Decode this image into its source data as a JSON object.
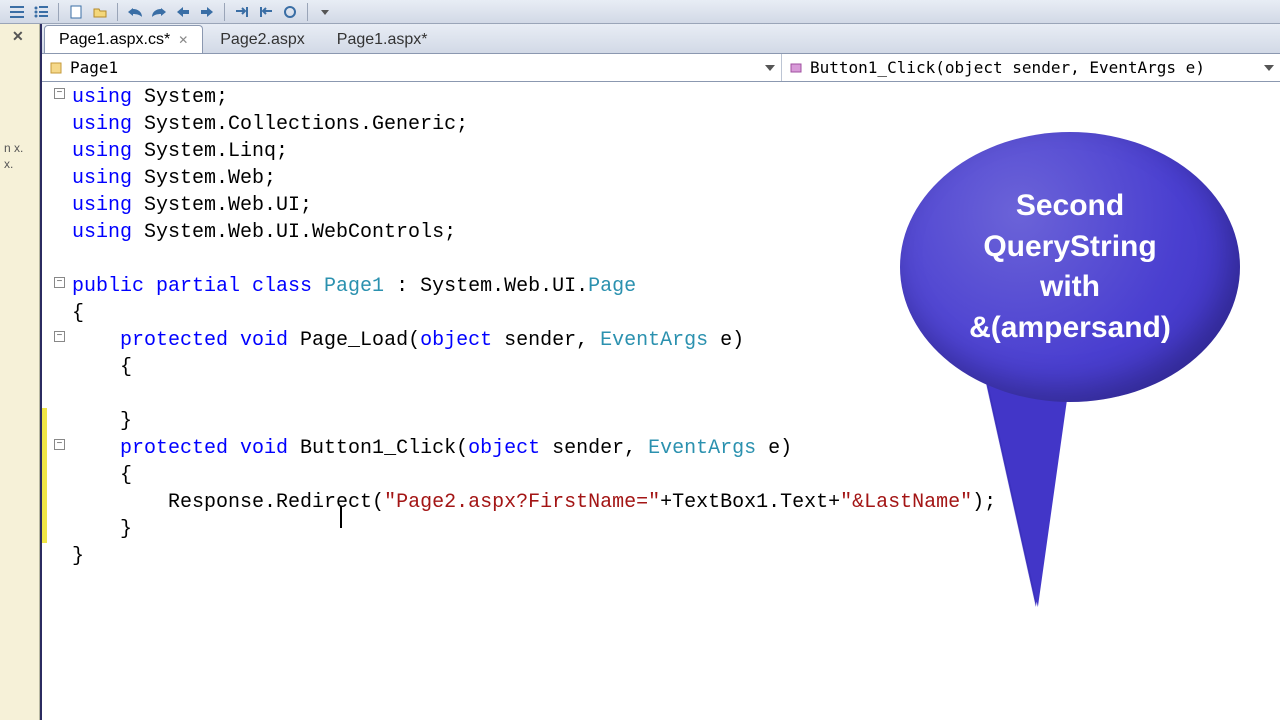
{
  "toolbar": {
    "buttons": [
      "menu",
      "list",
      "sep",
      "new",
      "open",
      "save",
      "sep",
      "undo",
      "redo",
      "back",
      "fwd",
      "sep",
      "step-out",
      "step-over",
      "stop",
      "sep",
      "dropdown"
    ]
  },
  "left_pane": {
    "text": "n\nx.\nx."
  },
  "tabs": [
    {
      "label": "Page1.aspx.cs*",
      "active": true,
      "closable": true
    },
    {
      "label": "Page2.aspx",
      "active": false,
      "closable": false
    },
    {
      "label": "Page1.aspx*",
      "active": false,
      "closable": false
    }
  ],
  "dropdowns": {
    "left": "Page1",
    "right": "Button1_Click(object sender, EventArgs e)"
  },
  "code": {
    "l1": "using",
    "l1b": " System;",
    "l2": "using",
    "l2b": " System.Collections.Generic;",
    "l3": "using",
    "l3b": " System.Linq;",
    "l4": "using",
    "l4b": " System.Web;",
    "l5": "using",
    "l5b": " System.Web.UI;",
    "l6": "using",
    "l6b": " System.Web.UI.WebControls;",
    "l8a": "public",
    "l8b": " partial",
    "l8c": " class",
    "l8d": " Page1",
    "l8e": " : System.Web.UI.",
    "l8f": "Page",
    "l9": "{",
    "l10a": "    protected",
    "l10b": " void",
    "l10c": " Page_Load(",
    "l10d": "object",
    "l10e": " sender, ",
    "l10f": "EventArgs",
    "l10g": " e)",
    "l11": "    {",
    "l13": "    }",
    "l14a": "    protected",
    "l14b": " void",
    "l14c": " Button1_Click(",
    "l14d": "object",
    "l14e": " sender, ",
    "l14f": "EventArgs",
    "l14g": " e)",
    "l15": "    {",
    "l16a": "        Response.Redirect(",
    "l16b": "\"Page2.aspx?FirstName=\"",
    "l16c": "+TextBox1.Text+",
    "l16d": "\"&LastName\"",
    "l16e": ");",
    "l17": "    }",
    "l18": "}"
  },
  "callout": {
    "line1": "Second",
    "line2": "QueryString",
    "line3": "with",
    "line4": "&(ampersand)"
  }
}
